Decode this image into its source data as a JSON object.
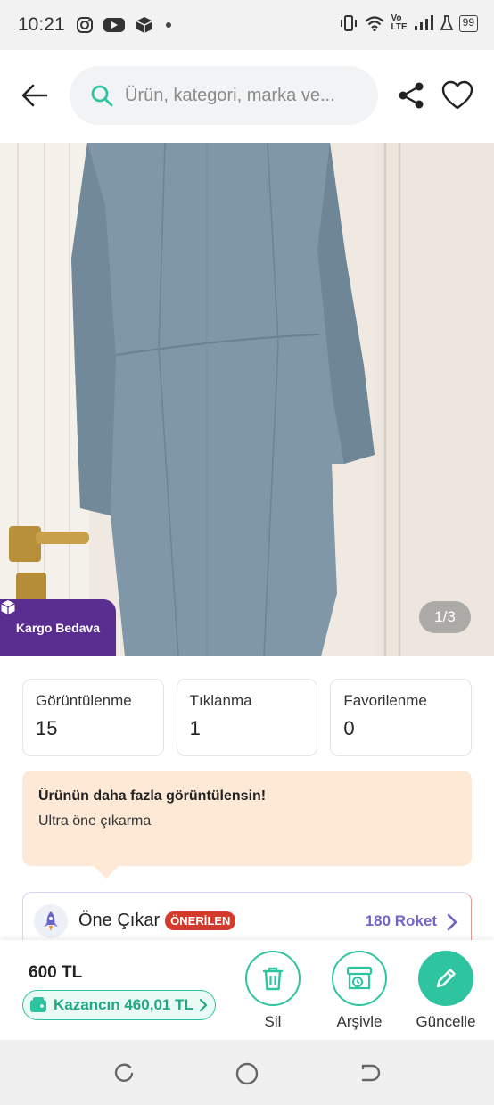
{
  "status_bar": {
    "time": "10:21",
    "left_icons": [
      "instagram-icon",
      "youtube-icon",
      "package-icon",
      "dot-icon"
    ],
    "right_icons": [
      "vibrate-icon",
      "wifi-icon",
      "volte-icon",
      "signal-icon",
      "lab-icon"
    ],
    "volte_label_top": "Vo",
    "volte_label_bottom": "LTE",
    "battery": "99"
  },
  "top_bar": {
    "search_placeholder": "Ürün, kategori, marka ve..."
  },
  "photo": {
    "shipping_badge": "Kargo Bedava",
    "page_indicator": "1/3"
  },
  "stats": [
    {
      "label": "Görüntülenme",
      "value": "15"
    },
    {
      "label": "Tıklanma",
      "value": "1"
    },
    {
      "label": "Favorilenme",
      "value": "0"
    }
  ],
  "promo": {
    "title": "Ürünün daha fazla görüntülensin!",
    "subtitle": "Ultra öne çıkarma"
  },
  "boost": {
    "title": "Öne Çıkar",
    "badge": "ÖNERİLEN",
    "price": "180 Roket"
  },
  "action_bar": {
    "price": "600 TL",
    "earning": "Kazancın 460,01 TL",
    "delete_label": "Sil",
    "archive_label": "Arşivle",
    "update_label": "Güncelle"
  },
  "colors": {
    "accent": "#2ec4a0",
    "brand_purple": "#5a2d91",
    "badge_red": "#d33a2c",
    "roket_purple": "#7066c4",
    "promo_bg": "#fde9d6"
  }
}
